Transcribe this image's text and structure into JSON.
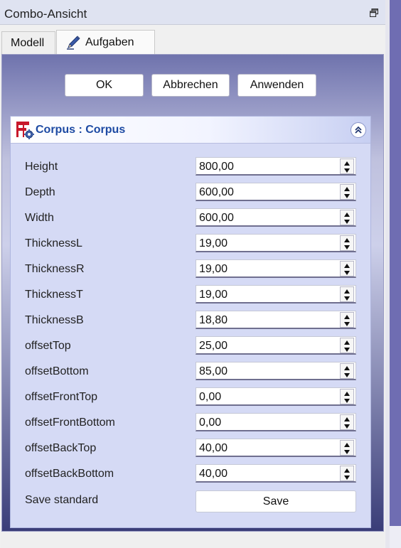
{
  "window": {
    "title": "Combo-Ansicht"
  },
  "tabs": [
    {
      "label": "Modell"
    },
    {
      "label": "Aufgaben"
    }
  ],
  "actions": {
    "ok": "OK",
    "cancel": "Abbrechen",
    "apply": "Anwenden"
  },
  "group": {
    "title": "Corpus : Corpus",
    "fields": [
      {
        "label": "Height",
        "value": "800,00"
      },
      {
        "label": "Depth",
        "value": "600,00"
      },
      {
        "label": "Width",
        "value": "600,00"
      },
      {
        "label": "ThicknessL",
        "value": "19,00"
      },
      {
        "label": "ThicknessR",
        "value": "19,00"
      },
      {
        "label": "ThicknessT",
        "value": "19,00"
      },
      {
        "label": "ThicknessB",
        "value": "18,80"
      },
      {
        "label": "offsetTop",
        "value": "25,00"
      },
      {
        "label": "offsetBottom",
        "value": "85,00"
      },
      {
        "label": "offsetFrontTop",
        "value": "0,00"
      },
      {
        "label": "offsetFrontBottom",
        "value": "0,00"
      },
      {
        "label": "offsetBackTop",
        "value": "40,00"
      },
      {
        "label": "offsetBackBottom",
        "value": "40,00"
      }
    ],
    "save": {
      "label": "Save standard",
      "button": "Save"
    }
  },
  "icons": {
    "float": "float-window-icon",
    "tab_task": "pencil-icon",
    "group_logo": "freecad-workbench-icon",
    "collapse": "chevron-double-up-icon",
    "spin_up": "triangle-up-icon",
    "spin_down": "triangle-down-icon"
  },
  "colors": {
    "group_title": "#1d4aa3",
    "group_bg": "#d5daf5",
    "panel_gradient_top": "#6f73ad",
    "panel_gradient_bottom": "#3a3d78"
  }
}
